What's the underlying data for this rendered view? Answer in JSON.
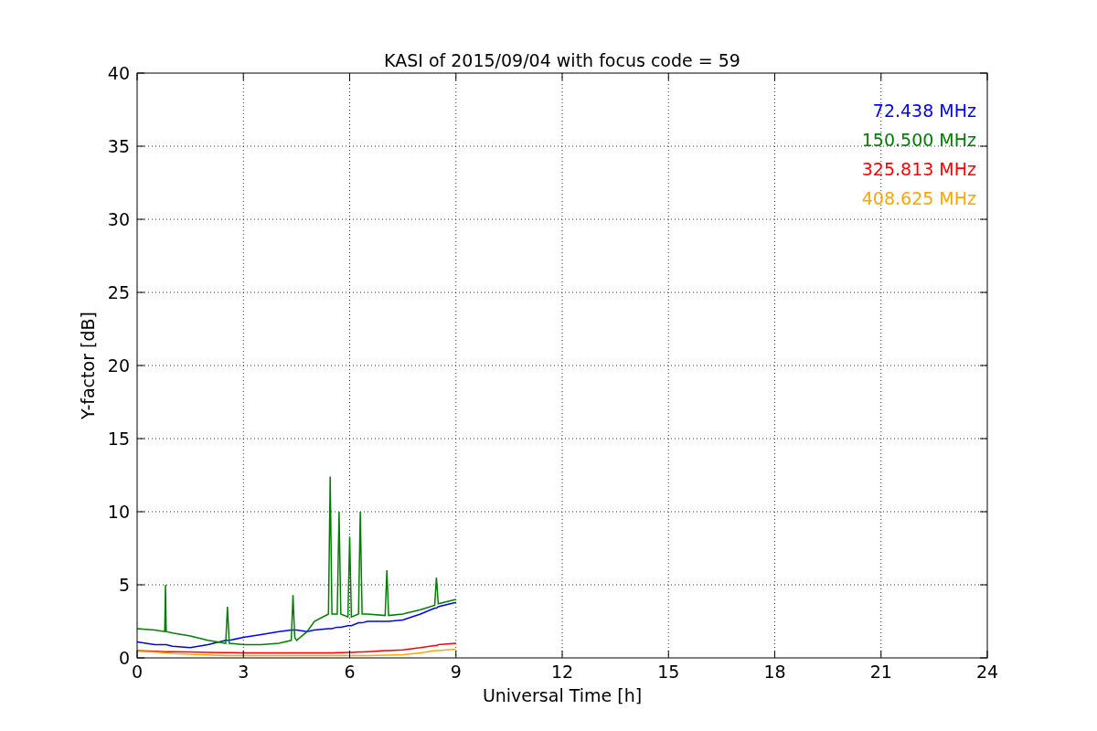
{
  "chart_data": {
    "type": "line",
    "title": "KASI of 2015/09/04 with focus code = 59",
    "xlabel": "Universal Time [h]",
    "ylabel": "Y-factor [dB]",
    "x": [
      0,
      0.5,
      0.78,
      0.8,
      0.82,
      1,
      1.5,
      2,
      2.5,
      2.55,
      2.6,
      3,
      3.5,
      4,
      4.35,
      4.4,
      4.45,
      4.5,
      4.8,
      5,
      5.4,
      5.45,
      5.5,
      5.65,
      5.7,
      5.75,
      5.95,
      6,
      6.05,
      6.25,
      6.3,
      6.35,
      6.5,
      7,
      7.05,
      7.1,
      7.5,
      8,
      8.4,
      8.45,
      8.5,
      9
    ],
    "series": [
      {
        "name": "72.438 MHz",
        "color": "#0000ff",
        "values": [
          1.1,
          0.9,
          0.9,
          0.9,
          0.9,
          0.8,
          0.7,
          0.9,
          1.2,
          1.2,
          1.2,
          1.4,
          1.6,
          1.8,
          1.9,
          1.9,
          1.9,
          1.9,
          1.8,
          1.9,
          2.0,
          2.0,
          2.0,
          2.1,
          2.1,
          2.1,
          2.2,
          2.2,
          2.2,
          2.4,
          2.4,
          2.4,
          2.5,
          2.5,
          2.5,
          2.5,
          2.6,
          3.0,
          3.4,
          3.4,
          3.5,
          3.8
        ]
      },
      {
        "name": "150.500 MHz",
        "color": "#008000",
        "values": [
          2.0,
          1.9,
          1.8,
          5.0,
          1.8,
          1.7,
          1.5,
          1.2,
          1.0,
          3.5,
          1.0,
          0.9,
          0.9,
          1.0,
          1.2,
          4.3,
          1.4,
          1.2,
          1.8,
          2.5,
          3.0,
          12.4,
          3.0,
          3.0,
          10.0,
          3.0,
          2.8,
          8.3,
          2.8,
          3.0,
          10.0,
          3.0,
          3.0,
          2.9,
          6.0,
          2.9,
          3.0,
          3.3,
          3.6,
          5.5,
          3.7,
          4.0
        ]
      },
      {
        "name": "325.813 MHz",
        "color": "#ff0000",
        "values": [
          0.5,
          0.45,
          0.42,
          0.42,
          0.42,
          0.42,
          0.4,
          0.38,
          0.36,
          0.36,
          0.36,
          0.35,
          0.35,
          0.35,
          0.35,
          0.35,
          0.35,
          0.35,
          0.35,
          0.35,
          0.35,
          0.35,
          0.35,
          0.36,
          0.36,
          0.36,
          0.38,
          0.38,
          0.38,
          0.4,
          0.4,
          0.4,
          0.42,
          0.5,
          0.5,
          0.5,
          0.55,
          0.7,
          0.85,
          0.85,
          0.9,
          1.0
        ]
      },
      {
        "name": "408.625 MHz",
        "color": "#ffa500",
        "values": [
          0.45,
          0.4,
          0.35,
          0.35,
          0.35,
          0.3,
          0.25,
          0.2,
          0.15,
          0.15,
          0.15,
          0.15,
          0.15,
          0.15,
          0.15,
          0.15,
          0.15,
          0.15,
          0.15,
          0.15,
          0.15,
          0.15,
          0.15,
          0.15,
          0.15,
          0.15,
          0.15,
          0.15,
          0.15,
          0.15,
          0.15,
          0.15,
          0.15,
          0.18,
          0.18,
          0.18,
          0.22,
          0.35,
          0.5,
          0.5,
          0.5,
          0.6
        ]
      }
    ],
    "xlim": [
      0,
      24
    ],
    "ylim": [
      0,
      40
    ],
    "xticks": [
      0,
      3,
      6,
      9,
      12,
      15,
      18,
      21,
      24
    ],
    "yticks": [
      0,
      5,
      10,
      15,
      20,
      25,
      30,
      35,
      40
    ],
    "grid": true
  }
}
